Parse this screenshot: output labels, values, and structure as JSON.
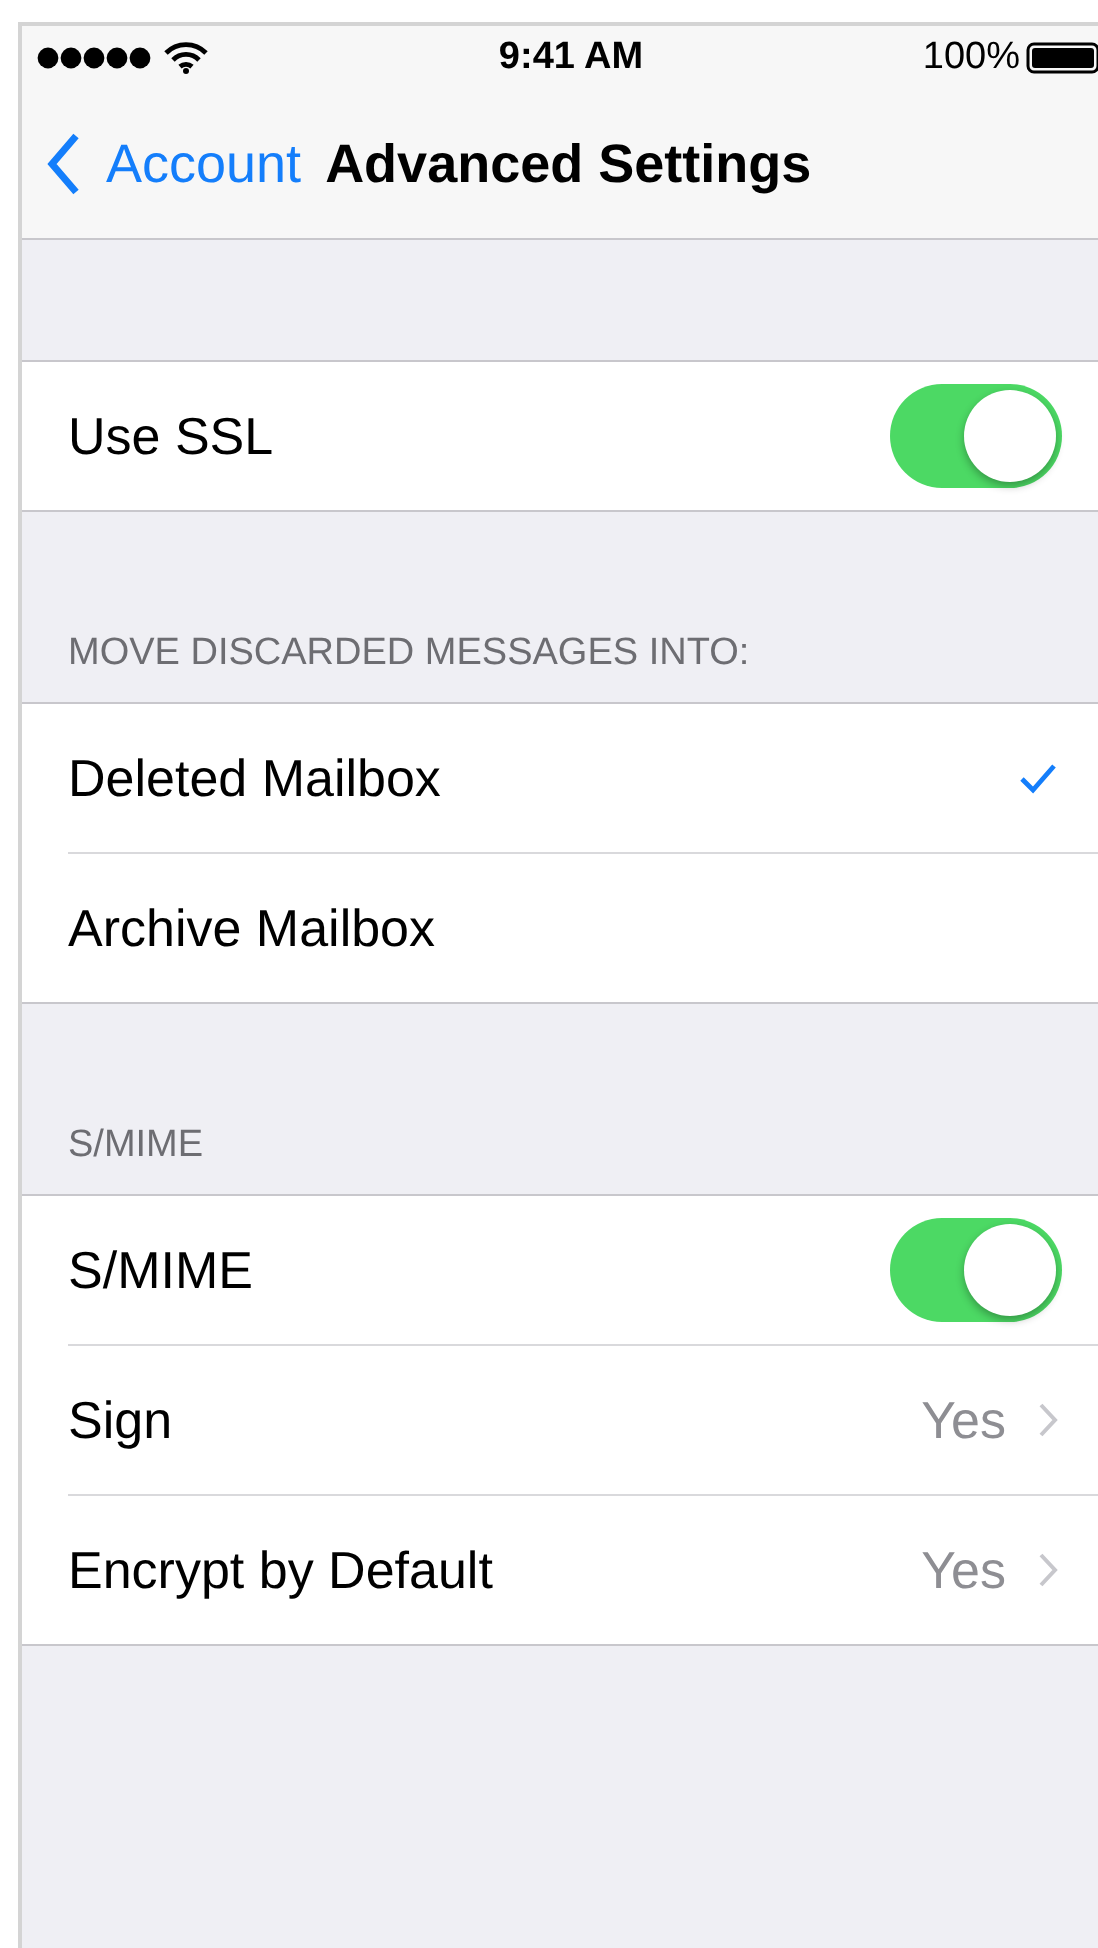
{
  "status_bar": {
    "time": "9:41 AM",
    "battery": "100%"
  },
  "nav": {
    "back": "Account",
    "title": "Advanced Settings"
  },
  "sections": [
    {
      "rows": [
        {
          "kind": "toggle",
          "label": "Use SSL",
          "on": true
        }
      ]
    },
    {
      "header": "MOVE DISCARDED MESSAGES INTO:",
      "rows": [
        {
          "kind": "check",
          "label": "Deleted Mailbox",
          "selected": true
        },
        {
          "kind": "check",
          "label": "Archive Mailbox",
          "selected": false
        }
      ]
    },
    {
      "header": "S/MIME",
      "rows": [
        {
          "kind": "toggle",
          "label": "S/MIME",
          "on": true
        },
        {
          "kind": "detail",
          "label": "Sign",
          "value": "Yes"
        },
        {
          "kind": "detail",
          "label": "Encrypt by Default",
          "value": "Yes"
        }
      ]
    }
  ]
}
